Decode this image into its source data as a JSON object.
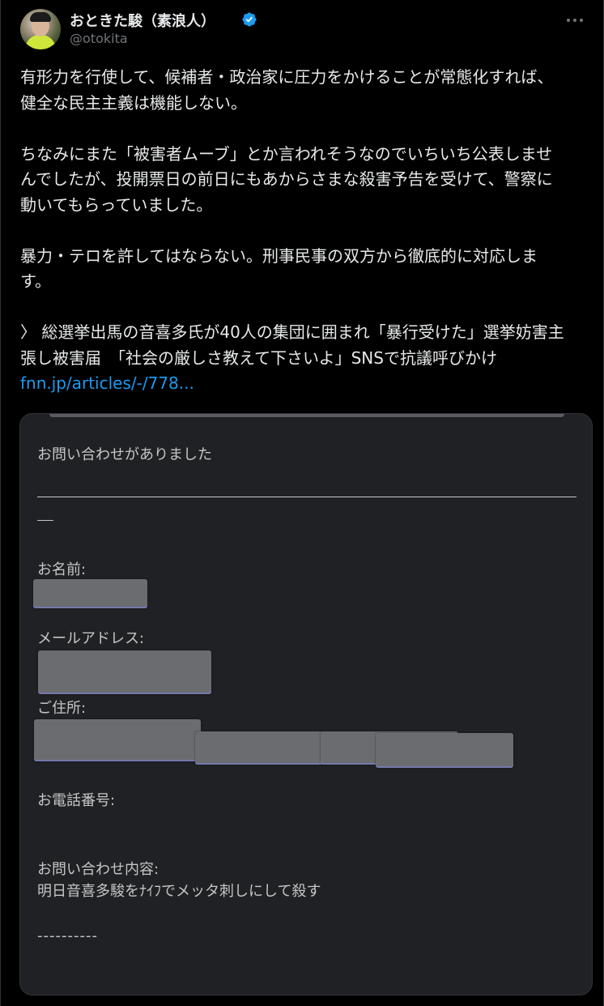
{
  "user": {
    "display_name": "おときた駿（素浪人）",
    "handle": "@otokita"
  },
  "tweet": {
    "paragraph_1": "有形力を行使して、候補者・政治家に圧力をかけることが常態化すれば、\n健全な民主主義は機能しない。",
    "paragraph_2": "ちなみにまた「被害者ムーブ」とか言われそうなのでいちいち公表しませ\nんでしたが、投開票日の前日にもあからさまな殺害予告を受けて、警察に\n動いてもらっていました。",
    "paragraph_3": "暴力・テロを許してはならない。刑事民事の双方から徹底的に対応しま\nす。",
    "quote_prefix": "〉",
    "quote_text": "総選挙出馬の音喜多氏が40人の集団に囲まれ「暴行受けた」選挙妨害主\n張し被害届　「社会の厳しさ教えて下さいよ」SNSで抗議呼びかけ",
    "link_text": "fnn.jp/articles/-/778..."
  },
  "image_card": {
    "heading": "お問い合わせがありました",
    "name_label": "お名前:",
    "email_label": "メールアドレス:",
    "address_label": "ご住所:",
    "phone_label": "お電話番号:",
    "inquiry_label": "お問い合わせ内容:",
    "inquiry_body": "明日音喜多駿をﾅｲﾌでメッタ刺しにして殺す",
    "footer_dashes": "----------"
  },
  "colors": {
    "background": "#000000",
    "text": "#e7e9ea",
    "secondary": "#71767b",
    "link": "#1d9bf0",
    "verified": "#1d9bf0",
    "card_background": "#202124"
  },
  "icons": {
    "verified": "verified-badge-icon",
    "more": "more-options-icon"
  }
}
